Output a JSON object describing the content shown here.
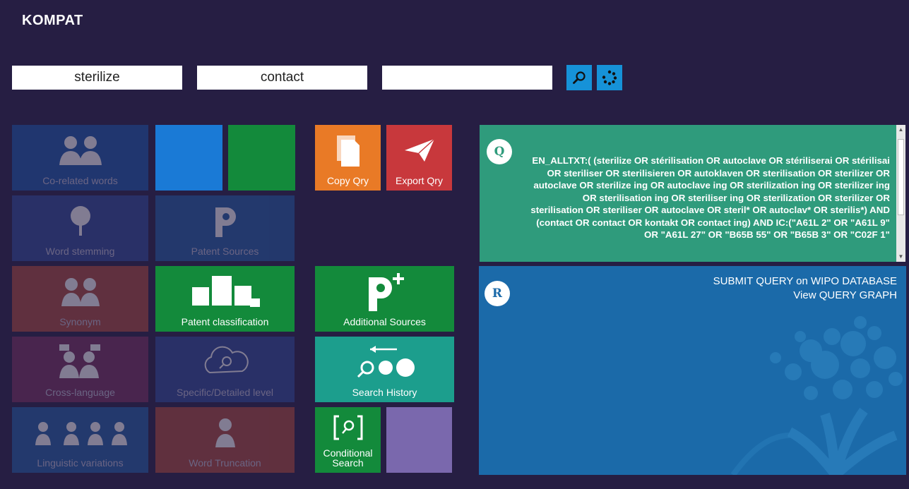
{
  "app": {
    "title": "KOMPAT"
  },
  "search": {
    "term1": "sterilize",
    "term2": "contact",
    "term3": "",
    "search_button_icon": "search-icon",
    "reset_button_icon": "refresh-icon"
  },
  "tiles": {
    "correlated_words": "Co-related words",
    "word_stemming": "Word stemming",
    "patent_sources": "Patent Sources",
    "synonym": "Synonym",
    "patent_classification": "Patent classification",
    "cross_language": "Cross-language",
    "specific_detailed": "Specific/Detailed level",
    "linguistic_variations": "Linguistic variations",
    "word_truncation": "Word Truncation",
    "copy_qry": "Copy Qry",
    "export_qry": "Export Qry",
    "additional_sources": "Additional Sources",
    "search_history": "Search History",
    "conditional_search": "Conditional Search"
  },
  "query_panel": {
    "badge": "Q",
    "text": "EN_ALLTXT:( (sterilize OR stérilisation OR autoclave OR stériliserai OR stérilisai OR steriliser OR sterilisieren OR autoklaven OR sterilisation OR sterilizer OR autoclave OR sterilize ing OR autoclave ing OR sterilization ing OR sterilizer ing OR sterilisation ing OR steriliser ing OR sterilization OR sterilizer OR sterilisation OR steriliser OR autoclave OR steril* OR autoclav* OR sterilis*) AND (contact OR contact OR kontakt OR contact ing) AND IC:(\"A61L 2\" OR \"A61L 9\" OR \"A61L 27\" OR \"B65B 55\" OR \"B65B 3\" OR \"C02F 1\""
  },
  "result_panel": {
    "badge": "R",
    "submit_link": "SUBMIT QUERY on WIPO DATABASE",
    "graph_link": "View QUERY GRAPH"
  },
  "colors": {
    "background": "#261e43",
    "blue": "#1a7ad6",
    "green": "#138a3b",
    "orange": "#e97a26",
    "red": "#c8383c",
    "teal": "#1c9e8d",
    "query_bg": "#2f9b7c",
    "result_bg": "#1b6aa9",
    "lavender": "#7a68ad"
  }
}
